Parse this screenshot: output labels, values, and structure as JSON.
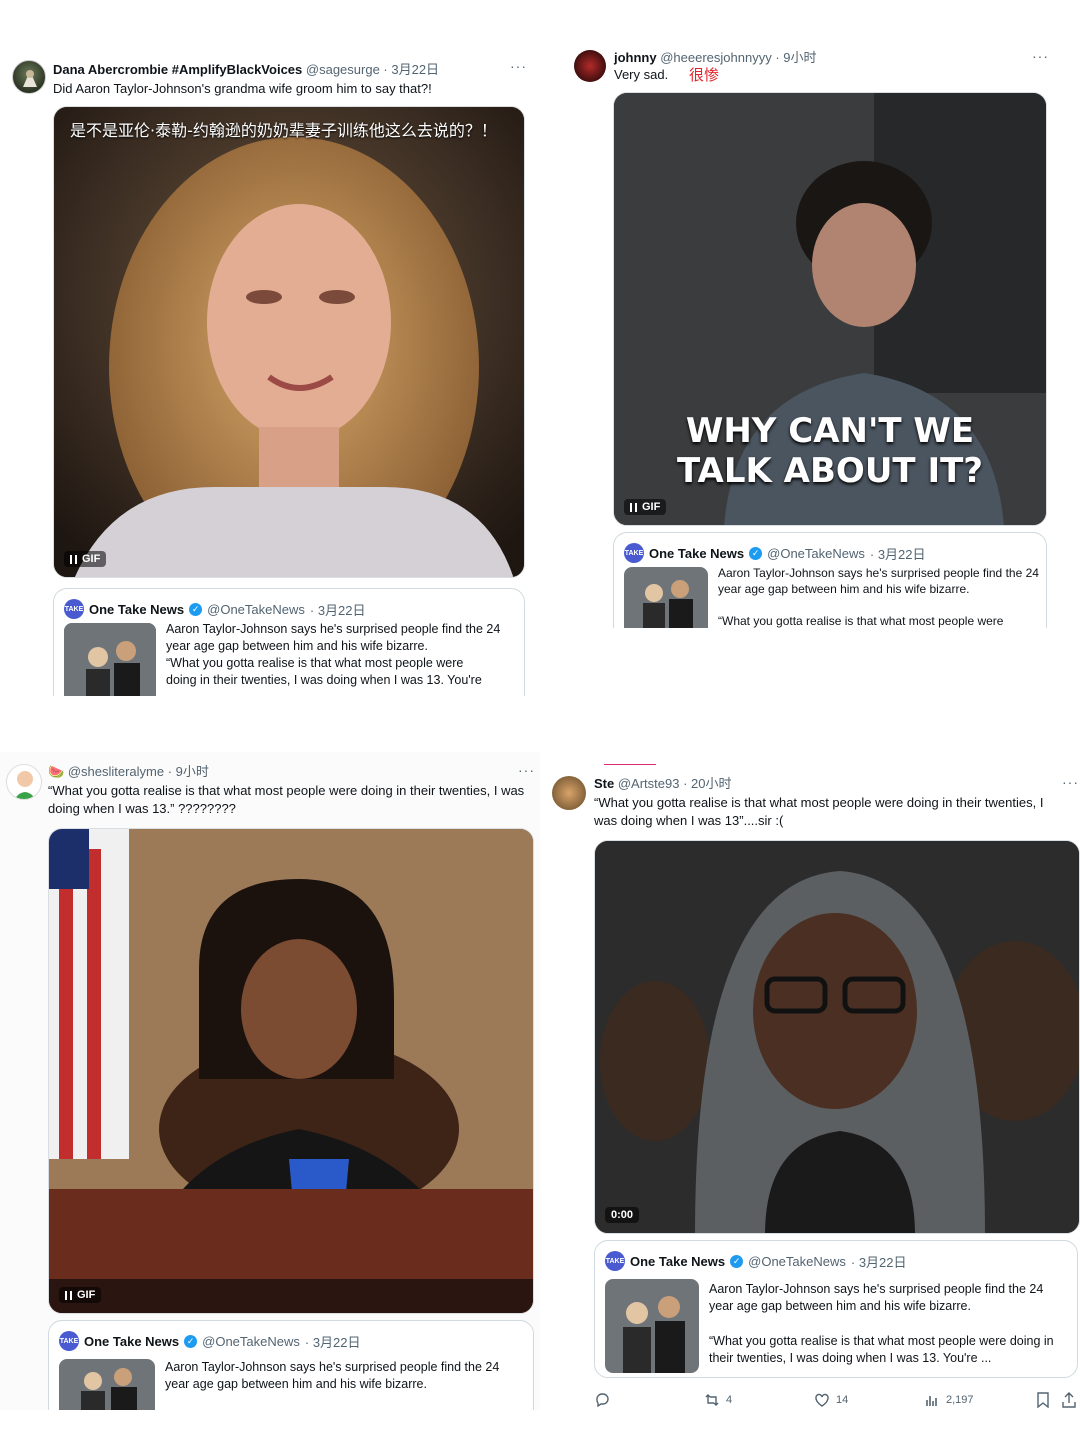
{
  "tweets": [
    {
      "name": "Dana Abercrombie #AmplifyBlackVoices",
      "handle": "@sagesurge",
      "time": "· 3月22日",
      "text": "Did Aaron Taylor-Johnson's grandma wife groom him to say that?!",
      "media_caption": "是不是亚伦·泰勒-约翰逊的奶奶辈妻子训练他这么去说的？！",
      "media_badge": "GIF",
      "more": "···"
    },
    {
      "name": "johnny",
      "handle": "@heeeresjohnnyyy",
      "time": "· 9小时",
      "text": "Very sad.",
      "annotation": "很惨",
      "media_caption_line1": "WHY CAN'T WE",
      "media_caption_line2": "TALK ABOUT IT?",
      "media_badge": "GIF",
      "more": "···"
    },
    {
      "name_emoji": "🍉",
      "handle": "@shesliteralyme",
      "time": "· 9小时",
      "text": "“What you gotta realise is that what most people were doing in their twenties, I was doing when I was 13.” ????????",
      "media_badge": "GIF",
      "more": "···"
    },
    {
      "name": "Ste",
      "handle": "@Artste93",
      "time": "· 20小时",
      "text": "“What you gotta realise is that what most people were doing in their twenties, I was doing when I was 13”....sir :(",
      "media_badge": "0:00",
      "more": "···",
      "actions": {
        "retweets": "4",
        "likes": "14",
        "views": "2,197"
      }
    }
  ],
  "quote": {
    "name": "One Take News",
    "handle": "@OneTakeNews",
    "time": "· 3月22日",
    "logo_text": "TAKE",
    "line1": "Aaron Taylor-Johnson says he's surprised people find the 24 year age gap between him and his wife bizarre.",
    "line2_short": "“What you gotta realise is that what most people were",
    "line2_p1_cut": "doing in their twenties, I was doing when I was 13. You're",
    "line2_full": "“What you gotta realise is that what most people were doing in their twenties, I was doing when I was 13. You're ..."
  },
  "colors": {
    "accent": "#1d9bf0",
    "annotation_red": "#e0262b",
    "quote_logo": "#4a5bd1"
  }
}
